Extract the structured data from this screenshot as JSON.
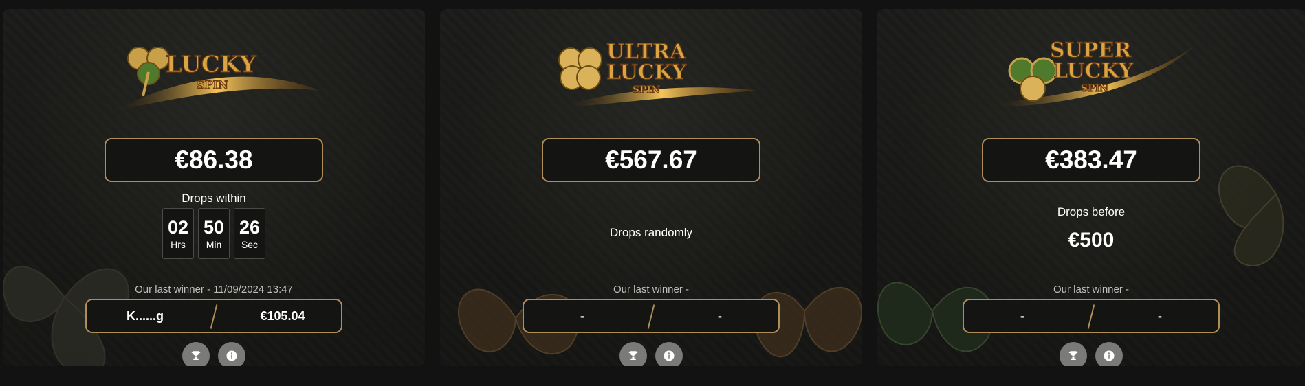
{
  "cards": [
    {
      "amount": "€86.38",
      "drop_label": "Drops within",
      "countdown": [
        {
          "value": "02",
          "unit": "Hrs"
        },
        {
          "value": "50",
          "unit": "Min"
        },
        {
          "value": "26",
          "unit": "Sec"
        }
      ],
      "winner_label": "Our last winner - 11/09/2024 13:47",
      "winner_name": "K......g",
      "winner_amount": "€105.04",
      "logo": {
        "line1": "LUCKY",
        "line2": "SPIN"
      }
    },
    {
      "amount": "€567.67",
      "drop_label": "Drops randomly",
      "winner_label": "Our last winner -",
      "winner_name": "-",
      "winner_amount": "-",
      "logo": {
        "line1": "ULTRA",
        "line2": "LUCKY",
        "line3": "SPIN"
      }
    },
    {
      "amount": "€383.47",
      "drop_label": "Drops before",
      "drop_value": "€500",
      "winner_label": "Our last winner -",
      "winner_name": "-",
      "winner_amount": "-",
      "logo": {
        "line1": "SUPER",
        "line2": "LUCKY",
        "line3": "SPIN"
      }
    }
  ],
  "icons": [
    "trophy-icon",
    "info-icon"
  ],
  "colors": {
    "gold_border": "#b08d57",
    "button_bg": "#7a7a78",
    "page_bg": "#121212"
  }
}
